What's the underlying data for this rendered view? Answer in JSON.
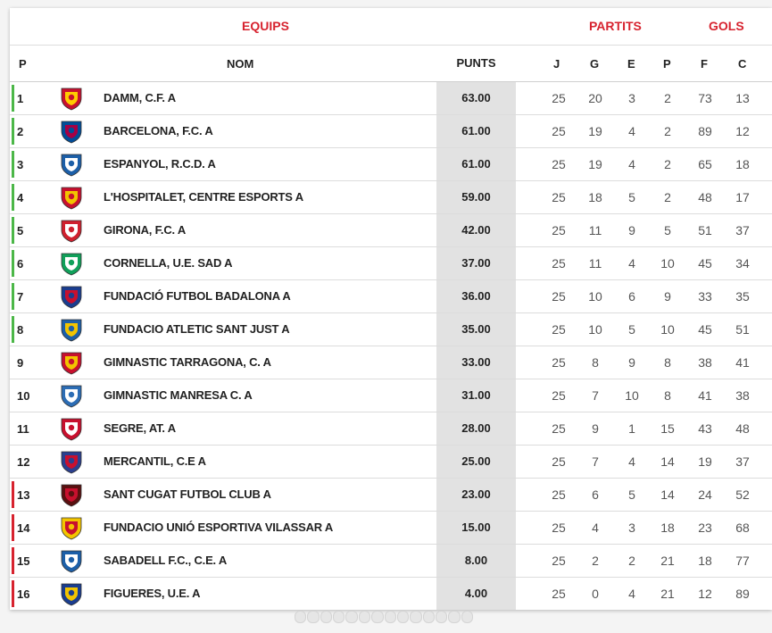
{
  "header": {
    "group_teams": "EQUIPS",
    "group_matches": "PARTITS",
    "group_goals": "GOLS"
  },
  "columns": {
    "pos": "P",
    "name": "NOM",
    "points": "PUNTS",
    "played": "J",
    "won": "G",
    "drawn": "E",
    "lost": "P",
    "goals_for": "F",
    "goals_against": "C"
  },
  "colors": {
    "accent": "#d7232f",
    "promotion": "#4cb748",
    "relegation": "#d7232f"
  },
  "rows": [
    {
      "pos": "1",
      "name": "DAMM, C.F. A",
      "points": "63.00",
      "j": "25",
      "g": "20",
      "e": "3",
      "p": "2",
      "f": "73",
      "c": "13",
      "zone": "promotion",
      "logo": "damm-crest-icon"
    },
    {
      "pos": "2",
      "name": "BARCELONA, F.C. A",
      "points": "61.00",
      "j": "25",
      "g": "19",
      "e": "4",
      "p": "2",
      "f": "89",
      "c": "12",
      "zone": "promotion",
      "logo": "barcelona-crest-icon"
    },
    {
      "pos": "3",
      "name": "ESPANYOL, R.C.D. A",
      "points": "61.00",
      "j": "25",
      "g": "19",
      "e": "4",
      "p": "2",
      "f": "65",
      "c": "18",
      "zone": "promotion",
      "logo": "espanyol-crest-icon"
    },
    {
      "pos": "4",
      "name": "L'HOSPITALET, CENTRE ESPORTS A",
      "points": "59.00",
      "j": "25",
      "g": "18",
      "e": "5",
      "p": "2",
      "f": "48",
      "c": "17",
      "zone": "promotion",
      "logo": "hospitalet-crest-icon"
    },
    {
      "pos": "5",
      "name": "GIRONA, F.C. A",
      "points": "42.00",
      "j": "25",
      "g": "11",
      "e": "9",
      "p": "5",
      "f": "51",
      "c": "37",
      "zone": "promotion",
      "logo": "girona-crest-icon"
    },
    {
      "pos": "6",
      "name": "CORNELLA, U.E. SAD A",
      "points": "37.00",
      "j": "25",
      "g": "11",
      "e": "4",
      "p": "10",
      "f": "45",
      "c": "34",
      "zone": "promotion",
      "logo": "cornella-crest-icon"
    },
    {
      "pos": "7",
      "name": "FUNDACIÓ FUTBOL BADALONA A",
      "points": "36.00",
      "j": "25",
      "g": "10",
      "e": "6",
      "p": "9",
      "f": "33",
      "c": "35",
      "zone": "promotion",
      "logo": "badalona-crest-icon"
    },
    {
      "pos": "8",
      "name": "FUNDACIO ATLETIC SANT JUST A",
      "points": "35.00",
      "j": "25",
      "g": "10",
      "e": "5",
      "p": "10",
      "f": "45",
      "c": "51",
      "zone": "promotion",
      "logo": "sant-just-crest-icon"
    },
    {
      "pos": "9",
      "name": "GIMNASTIC TARRAGONA, C. A",
      "points": "33.00",
      "j": "25",
      "g": "8",
      "e": "9",
      "p": "8",
      "f": "38",
      "c": "41",
      "zone": "none",
      "logo": "tarragona-crest-icon"
    },
    {
      "pos": "10",
      "name": "GIMNASTIC MANRESA C. A",
      "points": "31.00",
      "j": "25",
      "g": "7",
      "e": "10",
      "p": "8",
      "f": "41",
      "c": "38",
      "zone": "none",
      "logo": "manresa-crest-icon"
    },
    {
      "pos": "11",
      "name": "SEGRE, AT. A",
      "points": "28.00",
      "j": "25",
      "g": "9",
      "e": "1",
      "p": "15",
      "f": "43",
      "c": "48",
      "zone": "none",
      "logo": "segre-crest-icon"
    },
    {
      "pos": "12",
      "name": "MERCANTIL, C.E A",
      "points": "25.00",
      "j": "25",
      "g": "7",
      "e": "4",
      "p": "14",
      "f": "19",
      "c": "37",
      "zone": "none",
      "logo": "mercantil-crest-icon"
    },
    {
      "pos": "13",
      "name": "SANT CUGAT FUTBOL CLUB A",
      "points": "23.00",
      "j": "25",
      "g": "6",
      "e": "5",
      "p": "14",
      "f": "24",
      "c": "52",
      "zone": "relegation",
      "logo": "sant-cugat-crest-icon"
    },
    {
      "pos": "14",
      "name": "FUNDACIO UNIÓ ESPORTIVA VILASSAR A",
      "points": "15.00",
      "j": "25",
      "g": "4",
      "e": "3",
      "p": "18",
      "f": "23",
      "c": "68",
      "zone": "relegation",
      "logo": "vilassar-crest-icon"
    },
    {
      "pos": "15",
      "name": "SABADELL F.C., C.E. A",
      "points": "8.00",
      "j": "25",
      "g": "2",
      "e": "2",
      "p": "21",
      "f": "18",
      "c": "77",
      "zone": "relegation",
      "logo": "sabadell-crest-icon"
    },
    {
      "pos": "16",
      "name": "FIGUERES, U.E. A",
      "points": "4.00",
      "j": "25",
      "g": "0",
      "e": "4",
      "p": "21",
      "f": "12",
      "c": "89",
      "zone": "relegation",
      "logo": "figueres-crest-icon"
    }
  ]
}
